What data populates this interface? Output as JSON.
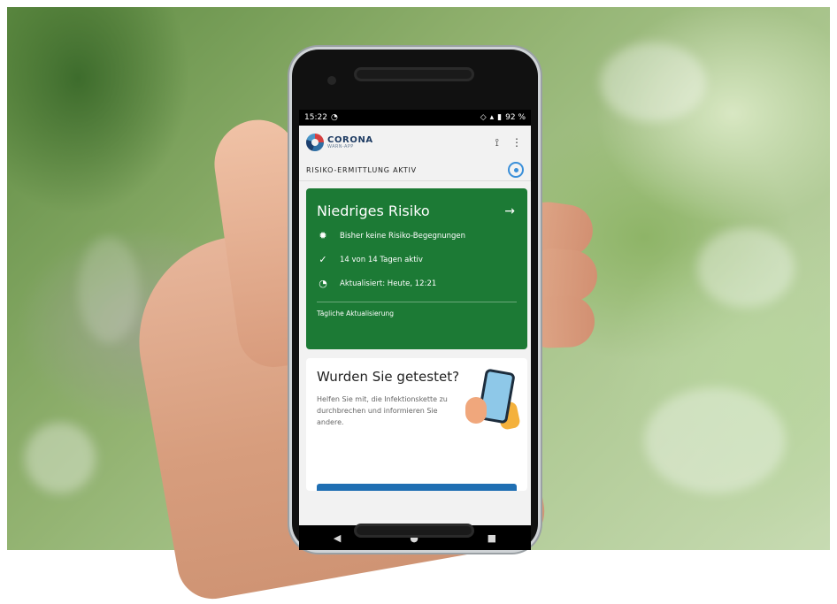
{
  "status_bar": {
    "time": "15:22",
    "battery": "92 %"
  },
  "app": {
    "logo_title": "CORONA",
    "logo_subtitle": "WARN-APP",
    "share_icon": "share-icon",
    "menu_icon": "more-vertical-icon",
    "status_text": "RISIKO-ERMITTLUNG AKTIV"
  },
  "risk_card": {
    "title": "Niedriges Risiko",
    "items": [
      {
        "icon": "virus-icon",
        "text": "Bisher keine Risiko-Begegnungen"
      },
      {
        "icon": "check-circle-icon",
        "text": "14 von 14 Tagen aktiv"
      },
      {
        "icon": "clock-icon",
        "text": "Aktualisiert: Heute, 12:21"
      }
    ],
    "footer": "Tägliche Aktualisierung",
    "color": "#1c7a35"
  },
  "test_card": {
    "title": "Wurden Sie getestet?",
    "text": "Helfen Sie mit, die Infektionskette zu durchbrechen und informieren Sie andere."
  },
  "nav": {
    "back": "◀",
    "home": "●",
    "recent": "■"
  }
}
